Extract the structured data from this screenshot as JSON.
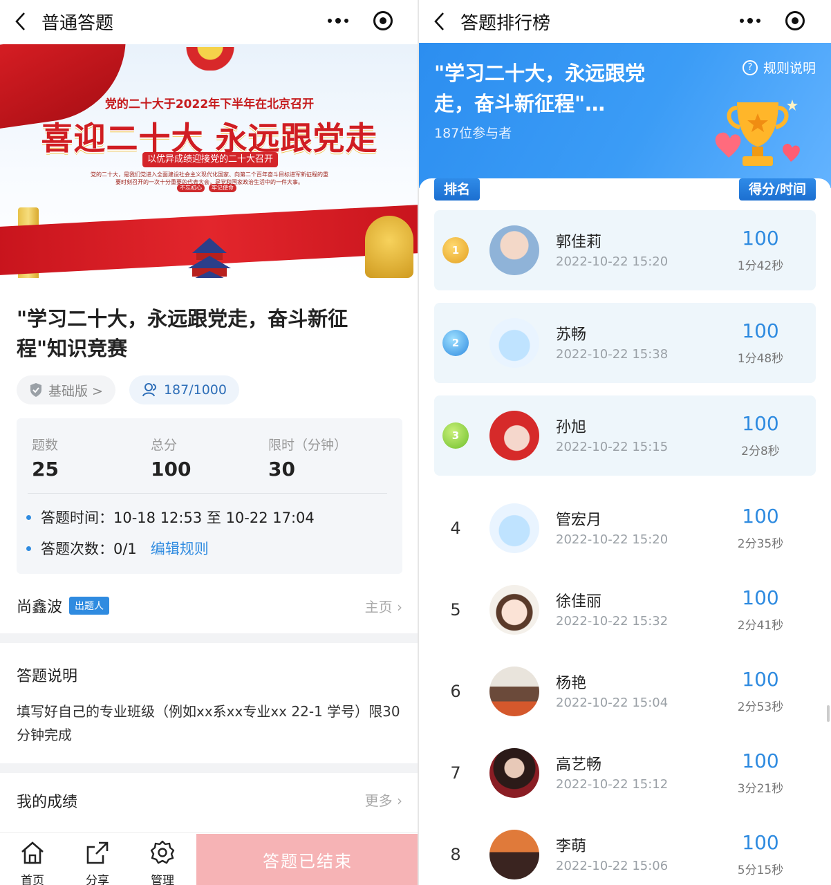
{
  "left": {
    "nav_title": "普通答题",
    "banner": {
      "line1": "党的二十大于2022年下半年在北京召开",
      "headline": "喜迎二十大 永远跟党走",
      "line2": "以优异成绩迎接党的二十大召开",
      "line3": "党的二十大，是我们党进入全面建设社会主义现代化国家、向第二个百年奋斗目标进军新征程的重要时刻召开的一次十分重要的代表大会，是党和国家政治生活中的一件大事。",
      "tag1": "不忘初心",
      "tag2": "牢记使命"
    },
    "quiz_title": "\"学习二十大，永远跟党走，奋斗新征程\"知识竞赛",
    "chip_version": "基础版 >",
    "chip_participants": "187/1000",
    "stats": {
      "q_label": "题数",
      "q_value": "25",
      "score_label": "总分",
      "score_value": "100",
      "time_label": "限时（分钟）",
      "time_value": "30"
    },
    "rule_time": "答题时间：10-18 12:53 至 10-22 17:04",
    "rule_count": "答题次数：0/1",
    "edit_rules": "编辑规则",
    "author_name": "尚鑫波",
    "author_tag": "出题人",
    "author_home": "主页 ›",
    "desc_heading": "答题说明",
    "desc_text": "填写好自己的专业班级（例如xx系xx专业xx 22-1   学号）限30分钟完成",
    "mine_heading": "我的成绩",
    "mine_more": "更多 ›",
    "tabs": {
      "home": "首页",
      "share": "分享",
      "manage": "管理"
    },
    "ended_button": "答题已结束"
  },
  "right": {
    "nav_title": "答题排行榜",
    "banner_title": "\"学习二十大，永远跟党走，奋斗新征程\"…",
    "participants": "187位参与者",
    "rules_link": "规则说明",
    "col_rank": "排名",
    "col_score": "得分/时间",
    "rows": [
      {
        "rank": "1",
        "name": "郭佳莉",
        "time": "2022-10-22 15:20",
        "score": "100",
        "dur": "1分42秒"
      },
      {
        "rank": "2",
        "name": "苏畅",
        "time": "2022-10-22 15:38",
        "score": "100",
        "dur": "1分48秒"
      },
      {
        "rank": "3",
        "name": "孙旭",
        "time": "2022-10-22 15:15",
        "score": "100",
        "dur": "2分8秒"
      },
      {
        "rank": "4",
        "name": "管宏月",
        "time": "2022-10-22 15:20",
        "score": "100",
        "dur": "2分35秒"
      },
      {
        "rank": "5",
        "name": "徐佳丽",
        "time": "2022-10-22 15:32",
        "score": "100",
        "dur": "2分41秒"
      },
      {
        "rank": "6",
        "name": "杨艳",
        "time": "2022-10-22 15:04",
        "score": "100",
        "dur": "2分53秒"
      },
      {
        "rank": "7",
        "name": "高艺畅",
        "time": "2022-10-22 15:12",
        "score": "100",
        "dur": "3分21秒"
      },
      {
        "rank": "8",
        "name": "李萌",
        "time": "2022-10-22 15:06",
        "score": "100",
        "dur": "5分15秒"
      }
    ]
  },
  "colors": {
    "accent": "#2f8be0",
    "ended": "#f6b3b5",
    "banner_blue": "#3b9cf6",
    "party_red": "#d01d22"
  }
}
